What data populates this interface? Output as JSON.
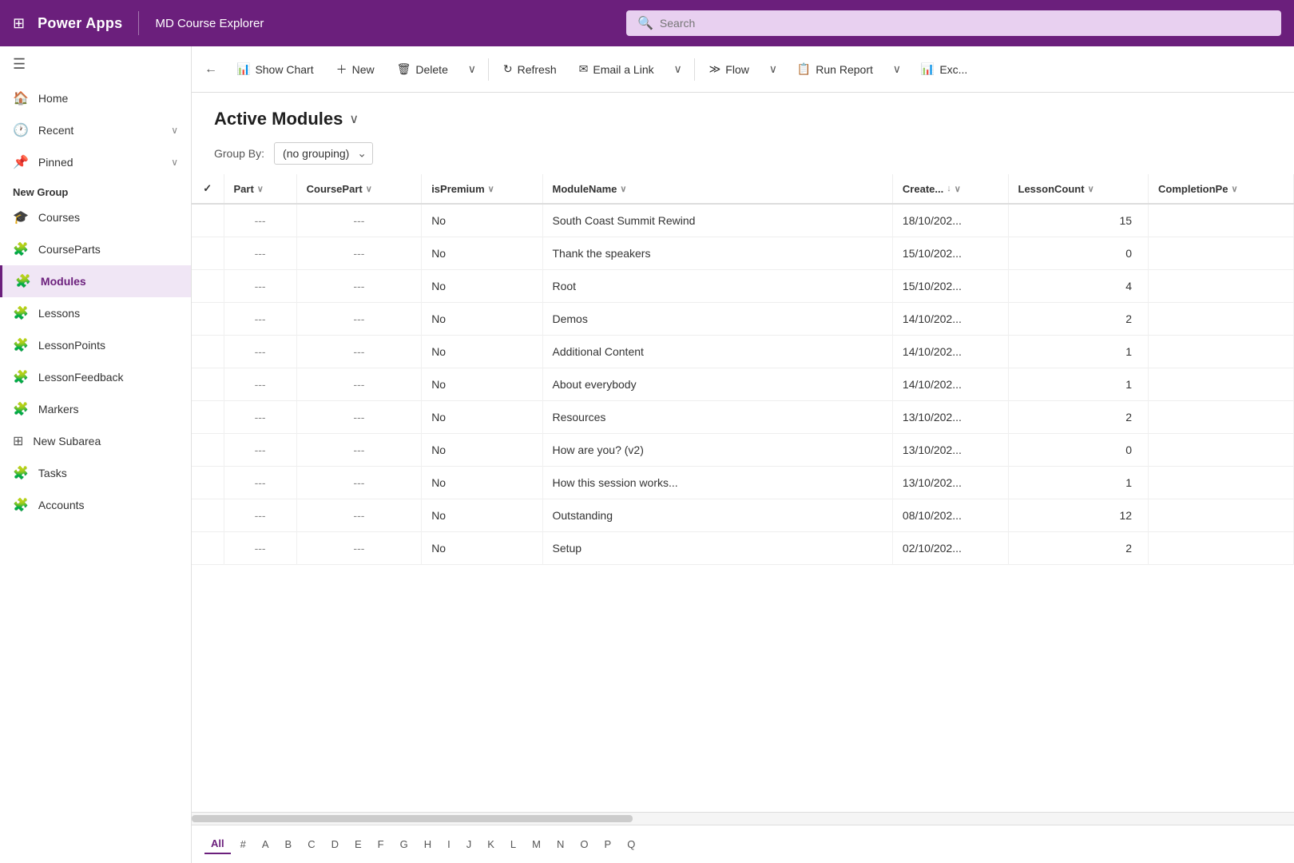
{
  "app": {
    "title": "Power Apps",
    "subtitle": "MD Course Explorer",
    "search_placeholder": "Search"
  },
  "toolbar": {
    "back_label": "←",
    "show_chart_label": "Show Chart",
    "new_label": "New",
    "delete_label": "Delete",
    "refresh_label": "Refresh",
    "email_link_label": "Email a Link",
    "flow_label": "Flow",
    "run_report_label": "Run Report",
    "excel_label": "Exc..."
  },
  "page": {
    "title": "Active Modules",
    "groupby_label": "Group By:",
    "groupby_value": "(no grouping)"
  },
  "table": {
    "columns": [
      {
        "key": "check",
        "label": "✓",
        "sort": false
      },
      {
        "key": "part",
        "label": "Part",
        "sort": true
      },
      {
        "key": "coursepart",
        "label": "CoursePart",
        "sort": true
      },
      {
        "key": "ispremium",
        "label": "isPremium",
        "sort": true
      },
      {
        "key": "modulename",
        "label": "ModuleName",
        "sort": true
      },
      {
        "key": "created",
        "label": "Create...",
        "sort": true,
        "active": true
      },
      {
        "key": "lessoncount",
        "label": "LessonCount",
        "sort": true
      },
      {
        "key": "completionpe",
        "label": "CompletionPe",
        "sort": true
      }
    ],
    "rows": [
      {
        "part": "---",
        "coursepart": "---",
        "ispremium": "No",
        "modulename": "South Coast Summit Rewind",
        "created": "18/10/202...",
        "lessoncount": 15,
        "completionpe": ""
      },
      {
        "part": "---",
        "coursepart": "---",
        "ispremium": "No",
        "modulename": "Thank the speakers",
        "created": "15/10/202...",
        "lessoncount": 0,
        "completionpe": ""
      },
      {
        "part": "---",
        "coursepart": "---",
        "ispremium": "No",
        "modulename": "Root",
        "created": "15/10/202...",
        "lessoncount": 4,
        "completionpe": ""
      },
      {
        "part": "---",
        "coursepart": "---",
        "ispremium": "No",
        "modulename": "Demos",
        "created": "14/10/202...",
        "lessoncount": 2,
        "completionpe": ""
      },
      {
        "part": "---",
        "coursepart": "---",
        "ispremium": "No",
        "modulename": "Additional Content",
        "created": "14/10/202...",
        "lessoncount": 1,
        "completionpe": ""
      },
      {
        "part": "---",
        "coursepart": "---",
        "ispremium": "No",
        "modulename": "About everybody",
        "created": "14/10/202...",
        "lessoncount": 1,
        "completionpe": ""
      },
      {
        "part": "---",
        "coursepart": "---",
        "ispremium": "No",
        "modulename": "Resources",
        "created": "13/10/202...",
        "lessoncount": 2,
        "completionpe": ""
      },
      {
        "part": "---",
        "coursepart": "---",
        "ispremium": "No",
        "modulename": "How are you? (v2)",
        "created": "13/10/202...",
        "lessoncount": 0,
        "completionpe": ""
      },
      {
        "part": "---",
        "coursepart": "---",
        "ispremium": "No",
        "modulename": "How this session works...",
        "created": "13/10/202...",
        "lessoncount": 1,
        "completionpe": ""
      },
      {
        "part": "---",
        "coursepart": "---",
        "ispremium": "No",
        "modulename": "Outstanding",
        "created": "08/10/202...",
        "lessoncount": 12,
        "completionpe": ""
      },
      {
        "part": "---",
        "coursepart": "---",
        "ispremium": "No",
        "modulename": "Setup",
        "created": "02/10/202...",
        "lessoncount": 2,
        "completionpe": ""
      }
    ]
  },
  "sidebar": {
    "items": [
      {
        "label": "Home",
        "icon": "🏠",
        "active": false
      },
      {
        "label": "Recent",
        "icon": "🕐",
        "active": false,
        "has_chevron": true
      },
      {
        "label": "Pinned",
        "icon": "📌",
        "active": false,
        "has_chevron": true
      }
    ],
    "new_group_label": "New Group",
    "group_items": [
      {
        "label": "Courses",
        "icon": "🎓",
        "active": false
      },
      {
        "label": "CourseParts",
        "icon": "🧩",
        "active": false
      },
      {
        "label": "Modules",
        "icon": "🧩",
        "active": true
      },
      {
        "label": "Lessons",
        "icon": "🧩",
        "active": false
      },
      {
        "label": "LessonPoints",
        "icon": "🧩",
        "active": false
      },
      {
        "label": "LessonFeedback",
        "icon": "🧩",
        "active": false
      },
      {
        "label": "Markers",
        "icon": "🧩",
        "active": false
      },
      {
        "label": "New Subarea",
        "icon": "⊞",
        "active": false
      },
      {
        "label": "Tasks",
        "icon": "🧩",
        "active": false
      },
      {
        "label": "Accounts",
        "icon": "🧩",
        "active": false
      }
    ]
  },
  "letter_nav": {
    "letters": [
      "All",
      "#",
      "A",
      "B",
      "C",
      "D",
      "E",
      "F",
      "G",
      "H",
      "I",
      "J",
      "K",
      "L",
      "M",
      "N",
      "O",
      "P",
      "Q"
    ],
    "active": "All"
  },
  "colors": {
    "brand_purple": "#6b1f7c",
    "brand_light": "#e8d0f0",
    "active_border": "#6b1f7c"
  }
}
